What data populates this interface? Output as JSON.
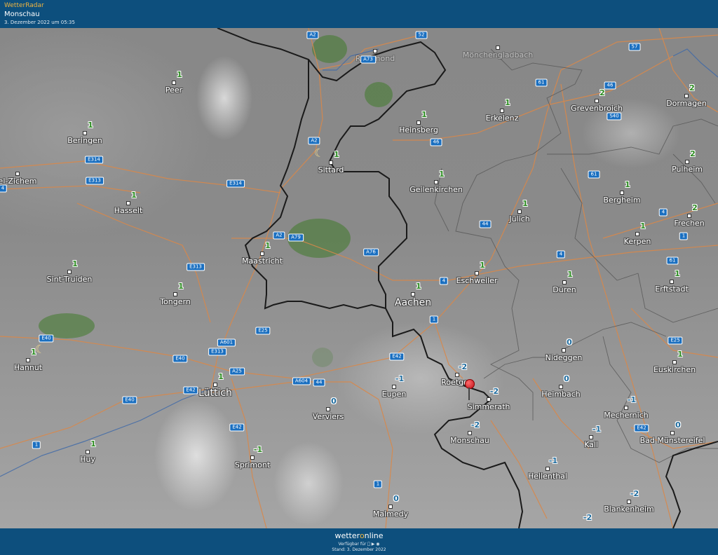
{
  "header": {
    "brand": "WetterRadar",
    "location": "Monschau",
    "datetime": "3. Dezember 2022 um 05:35"
  },
  "footer": {
    "logo_pre": "wetter",
    "logo_o": "o",
    "logo_post": "nline",
    "available": "Verfügbar für  ▶ ◉",
    "stand": "Stand: 3. Dezember 2022"
  },
  "colors": {
    "header_bg": "#0d4f7d",
    "road": "#d9884a",
    "border_country": "#1a1a1a",
    "border_region": "#555555",
    "radar_green": "#3f7a2a",
    "temp_positive": "#2a8a1f",
    "temp_negative": "#1d6b9e",
    "marker": "#d81a22",
    "brand_accent": "#f0b540"
  },
  "cities": [
    {
      "name": "Peer",
      "temp": "1",
      "sign": "green"
    },
    {
      "name": "Beringen",
      "temp": "1",
      "sign": "green"
    },
    {
      "name": "el-Zichem",
      "temp": "",
      "sign": "green"
    },
    {
      "name": "Hasselt",
      "temp": "1",
      "sign": "green"
    },
    {
      "name": "Sint-Truiden",
      "temp": "1",
      "sign": "green"
    },
    {
      "name": "Tongern",
      "temp": "1",
      "sign": "green"
    },
    {
      "name": "Hannut",
      "temp": "1",
      "sign": "green"
    },
    {
      "name": "Huy",
      "temp": "1",
      "sign": "green"
    },
    {
      "name": "Lüttich",
      "temp": "1",
      "sign": "green"
    },
    {
      "name": "Sprimont",
      "temp": "-1",
      "sign": "green"
    },
    {
      "name": "Maastricht",
      "temp": "1",
      "sign": "green"
    },
    {
      "name": "Sittard",
      "temp": "1",
      "sign": "green"
    },
    {
      "name": "Heinsberg",
      "temp": "1",
      "sign": "green"
    },
    {
      "name": "Geilenkirchen",
      "temp": "1",
      "sign": "green"
    },
    {
      "name": "Aachen",
      "temp": "1",
      "sign": "green"
    },
    {
      "name": "Eupen",
      "temp": "-1",
      "sign": "blue"
    },
    {
      "name": "Verviers",
      "temp": "0",
      "sign": "blue"
    },
    {
      "name": "Malmedy",
      "temp": "0",
      "sign": "blue"
    },
    {
      "name": "Roetgen",
      "temp": "-2",
      "sign": "blue"
    },
    {
      "name": "Simmerath",
      "temp": "-2",
      "sign": "blue"
    },
    {
      "name": "Monschau",
      "temp": "-2",
      "sign": "blue"
    },
    {
      "name": "Erkelenz",
      "temp": "1",
      "sign": "green"
    },
    {
      "name": "Grevenbroich",
      "temp": "2",
      "sign": "green"
    },
    {
      "name": "Dormagen",
      "temp": "2",
      "sign": "green"
    },
    {
      "name": "Pulheim",
      "temp": "2",
      "sign": "green"
    },
    {
      "name": "Bergheim",
      "temp": "1",
      "sign": "green"
    },
    {
      "name": "Frechen",
      "temp": "2",
      "sign": "green"
    },
    {
      "name": "Kerpen",
      "temp": "1",
      "sign": "green"
    },
    {
      "name": "Jülich",
      "temp": "1",
      "sign": "green"
    },
    {
      "name": "Eschweiler",
      "temp": "1",
      "sign": "green"
    },
    {
      "name": "Düren",
      "temp": "1",
      "sign": "green"
    },
    {
      "name": "Erftstadt",
      "temp": "1",
      "sign": "green"
    },
    {
      "name": "Nideggen",
      "temp": "0",
      "sign": "blue"
    },
    {
      "name": "Heimbach",
      "temp": "0",
      "sign": "blue"
    },
    {
      "name": "Euskirchen",
      "temp": "1",
      "sign": "green"
    },
    {
      "name": "Mechernich",
      "temp": "-1",
      "sign": "blue"
    },
    {
      "name": "Kall",
      "temp": "-1",
      "sign": "blue"
    },
    {
      "name": "Bad Münstereifel",
      "temp": "0",
      "sign": "blue"
    },
    {
      "name": "Hellenthal",
      "temp": "-1",
      "sign": "blue"
    },
    {
      "name": "Blankenheim",
      "temp": "-2",
      "sign": "blue"
    },
    {
      "name": "Mönchengladbach",
      "temp": "",
      "sign": "green"
    },
    {
      "name": "Roermond",
      "temp": "",
      "sign": "green"
    },
    {
      "name": "",
      "temp": "-2",
      "sign": "blue"
    }
  ],
  "roads": [
    "A2",
    "52",
    "57",
    "A73",
    "61",
    "46",
    "S40",
    "E314",
    "E313",
    "A2",
    "46",
    "61",
    "E314",
    "A2",
    "A79",
    "A76",
    "44",
    "4",
    "E313",
    "4",
    "4",
    "61",
    "1",
    "E25",
    "A601",
    "E40",
    "E313",
    "A25",
    "E40",
    "A604",
    "E42",
    "E40",
    "E42",
    "44",
    "1",
    "E25",
    "E42",
    "1",
    "E42",
    "1",
    "4"
  ]
}
